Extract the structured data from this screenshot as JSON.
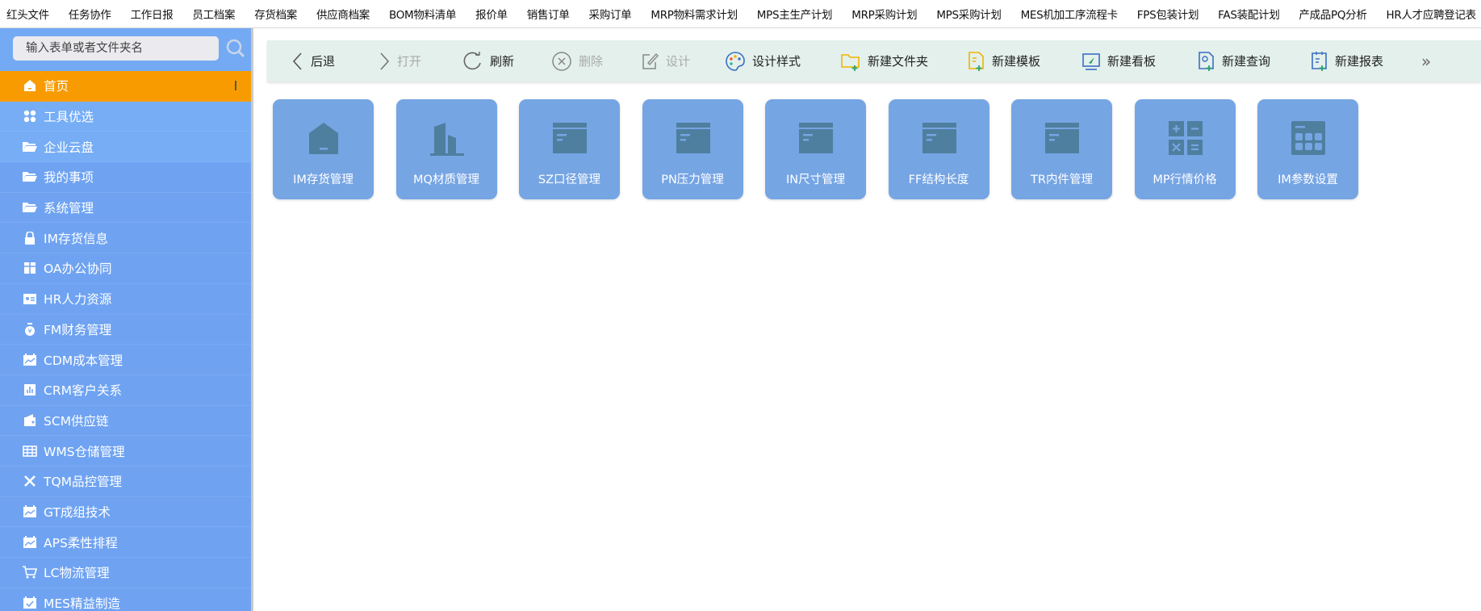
{
  "top_menu": [
    "红头文件",
    "任务协作",
    "工作日报",
    "员工档案",
    "存货档案",
    "供应商档案",
    "BOM物料清单",
    "报价单",
    "销售订单",
    "采购订单",
    "MRP物料需求计划",
    "MPS主生产计划",
    "MRP采购计划",
    "MPS采购计划",
    "MES机加工序流程卡",
    "FPS包装计划",
    "FAS装配计划",
    "产成品PQ分析",
    "HR人才应聘登记表"
  ],
  "sidebar": {
    "search_placeholder": "输入表单或者文件夹名",
    "items": [
      {
        "label": "首页",
        "icon": "home-icon"
      },
      {
        "label": "工具优选",
        "icon": "grid-icon"
      },
      {
        "label": "企业云盘",
        "icon": "folder-icon"
      },
      {
        "label": "我的事项",
        "icon": "folder-icon"
      },
      {
        "label": "系统管理",
        "icon": "folder-icon"
      },
      {
        "label": "IM存货信息",
        "icon": "lock-icon"
      },
      {
        "label": "OA办公协同",
        "icon": "gift-icon"
      },
      {
        "label": "HR人力资源",
        "icon": "id-card-icon"
      },
      {
        "label": "FM财务管理",
        "icon": "money-bag-icon"
      },
      {
        "label": "CDM成本管理",
        "icon": "chart-calendar-icon"
      },
      {
        "label": "CRM客户关系",
        "icon": "bar-chart-icon"
      },
      {
        "label": "SCM供应链",
        "icon": "wallet-icon"
      },
      {
        "label": "WMS仓储管理",
        "icon": "table-icon"
      },
      {
        "label": "TQM品控管理",
        "icon": "tools-icon"
      },
      {
        "label": "GT成组技术",
        "icon": "chart-calendar-icon"
      },
      {
        "label": "APS柔性排程",
        "icon": "chart-calendar-icon"
      },
      {
        "label": "LC物流管理",
        "icon": "cart-icon"
      },
      {
        "label": "MES精益制造",
        "icon": "calendar-check-icon"
      }
    ]
  },
  "toolbar": {
    "back": "后退",
    "open": "打开",
    "refresh": "刷新",
    "delete": "删除",
    "design": "设计",
    "design_style": "设计样式",
    "new_folder": "新建文件夹",
    "new_template": "新建模板",
    "new_board": "新建看板",
    "new_query": "新建查询",
    "new_report": "新建报表",
    "more": "»"
  },
  "tiles": [
    {
      "label": "IM存货管理",
      "icon": "house-icon"
    },
    {
      "label": "MQ材质管理",
      "icon": "building-icon"
    },
    {
      "label": "SZ口径管理",
      "icon": "window-icon"
    },
    {
      "label": "PN压力管理",
      "icon": "window-icon"
    },
    {
      "label": "IN尺寸管理",
      "icon": "window-icon"
    },
    {
      "label": "FF结构长度",
      "icon": "window-icon"
    },
    {
      "label": "TR内件管理",
      "icon": "window-icon"
    },
    {
      "label": "MP行情价格",
      "icon": "calculator-ops-icon"
    },
    {
      "label": "IM参数设置",
      "icon": "calculator-icon"
    }
  ],
  "colors": {
    "active": "#f89b00",
    "sidebar": "#6fa3f2",
    "tile": "#76a5e4",
    "tile_icon": "#4f7f9f",
    "toolbar": "#e3f0eb"
  }
}
